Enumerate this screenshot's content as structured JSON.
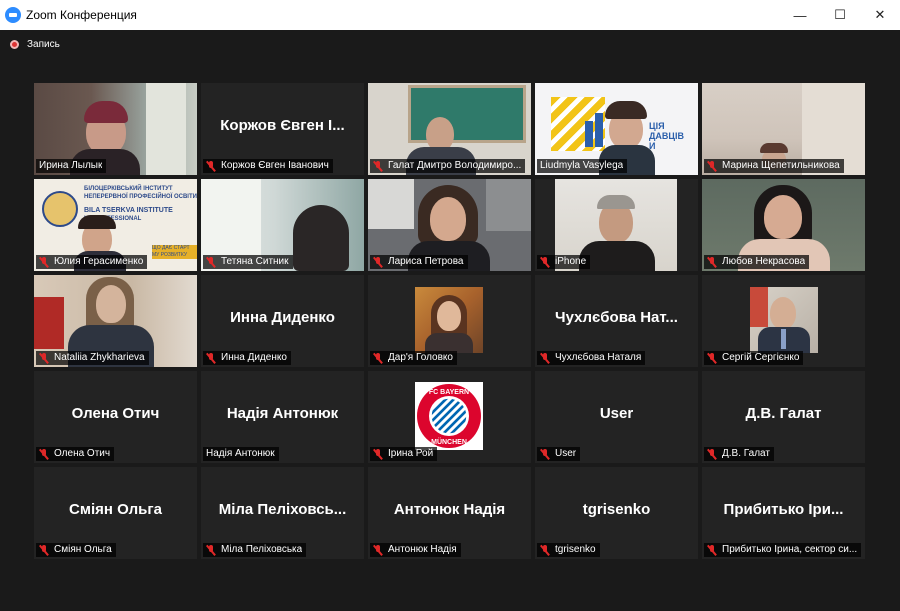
{
  "window": {
    "title": "Zoom Конференция",
    "minimize": "—",
    "maximize": "☐",
    "close": "✕"
  },
  "recording": {
    "label": "Запись"
  },
  "participants": [
    {
      "tag": "Ирина Лылык",
      "video": true,
      "muted": false,
      "active": true
    },
    {
      "tag": "Коржов Євген Іванович",
      "big": "Коржов Євген І...",
      "muted": true
    },
    {
      "tag": "Галат Дмитро Володимиро...",
      "video": true,
      "muted": true
    },
    {
      "tag": "Liudmyla Vasylega",
      "video": true,
      "muted": false,
      "overlay": [
        "ЦІЯ",
        "ДАВЦІВ",
        "И"
      ]
    },
    {
      "tag": "Марина Щепетильникова",
      "video": true,
      "muted": true
    },
    {
      "tag": "Юлия Герасименко",
      "video": true,
      "muted": true,
      "overlay": [
        "БІЛОЦЕРКІВСЬКИЙ ІНСТИТУТ",
        "НЕПЕРЕРВНОЇ ПРОФЕСІЙНОЇ ОСВІТИ",
        "BILA TSERKVA INSTITUTE",
        "US PROFESSIONAL",
        "ЩО ДАЄ СТАРТ",
        "МУ РОЗВИТКУ"
      ]
    },
    {
      "tag": "Тетяна Ситник",
      "video": true,
      "muted": true
    },
    {
      "tag": "Лариса Петрова",
      "video": true,
      "muted": true
    },
    {
      "tag": "iPhone",
      "video": true,
      "muted": true
    },
    {
      "tag": "Любов Некрасова",
      "video": true,
      "muted": true
    },
    {
      "tag": "Nataliia Zhykharieva",
      "video": true,
      "muted": true
    },
    {
      "tag": "Инна Диденко",
      "big": "Инна Диденко",
      "muted": true
    },
    {
      "tag": "Дар'я Головко",
      "avatar": true,
      "muted": true
    },
    {
      "tag": "Чухлєбова Наталя",
      "big": "Чухлєбова Нат...",
      "muted": true
    },
    {
      "tag": "Сергій Сергієнко",
      "avatar": true,
      "muted": true
    },
    {
      "tag": "Олена Отич",
      "big": "Олена Отич",
      "muted": true
    },
    {
      "tag": "Надія Антонюк",
      "big": "Надія Антонюк",
      "muted": false
    },
    {
      "tag": "Ірина Рой",
      "logo": true,
      "muted": true,
      "logo_text": [
        "FC BAYERN",
        "MÜNCHEN"
      ]
    },
    {
      "tag": "User",
      "big": "User",
      "muted": true
    },
    {
      "tag": "Д.В. Галат",
      "big": "Д.В. Галат",
      "muted": true
    },
    {
      "tag": "Сміян Ольга",
      "big": "Сміян Ольга",
      "muted": true
    },
    {
      "tag": "Міла Пеліховська",
      "big": "Міла Пеліховсь...",
      "muted": true
    },
    {
      "tag": "Антонюк Надія",
      "big": "Антонюк Надія",
      "muted": true
    },
    {
      "tag": "tgrisenko",
      "big": "tgrisenko",
      "muted": true
    },
    {
      "tag": "Прибитько Ірина, сектор си...",
      "big": "Прибитько Іри...",
      "muted": true
    }
  ],
  "colors": {
    "active_speaker_border": "#a4d957",
    "muted_icon": "#e02828",
    "tile_bg": "#232323",
    "app_bg": "#1a1a1a"
  }
}
